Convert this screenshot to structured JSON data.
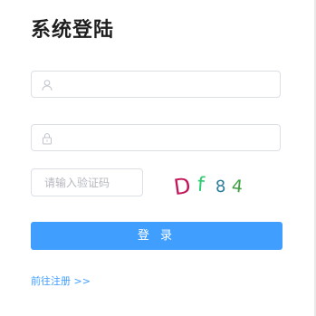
{
  "title": "系统登陆",
  "username": {
    "value": "",
    "placeholder": "",
    "icon": "user-icon"
  },
  "password": {
    "value": "",
    "placeholder": "",
    "icon": "lock-icon"
  },
  "captcha": {
    "placeholder": "请输入验证码",
    "chars": [
      {
        "text": "D",
        "color": "#c2185b"
      },
      {
        "text": "f",
        "color": "#2ecc71"
      },
      {
        "text": "8",
        "color": "#2e7d9a"
      },
      {
        "text": "4",
        "color": "#43a047"
      }
    ]
  },
  "login_button": "登 录",
  "register_link": "前往注册 >>",
  "colors": {
    "primary": "#409eff",
    "border": "#dcdfe6",
    "title": "#1f1f1f"
  }
}
